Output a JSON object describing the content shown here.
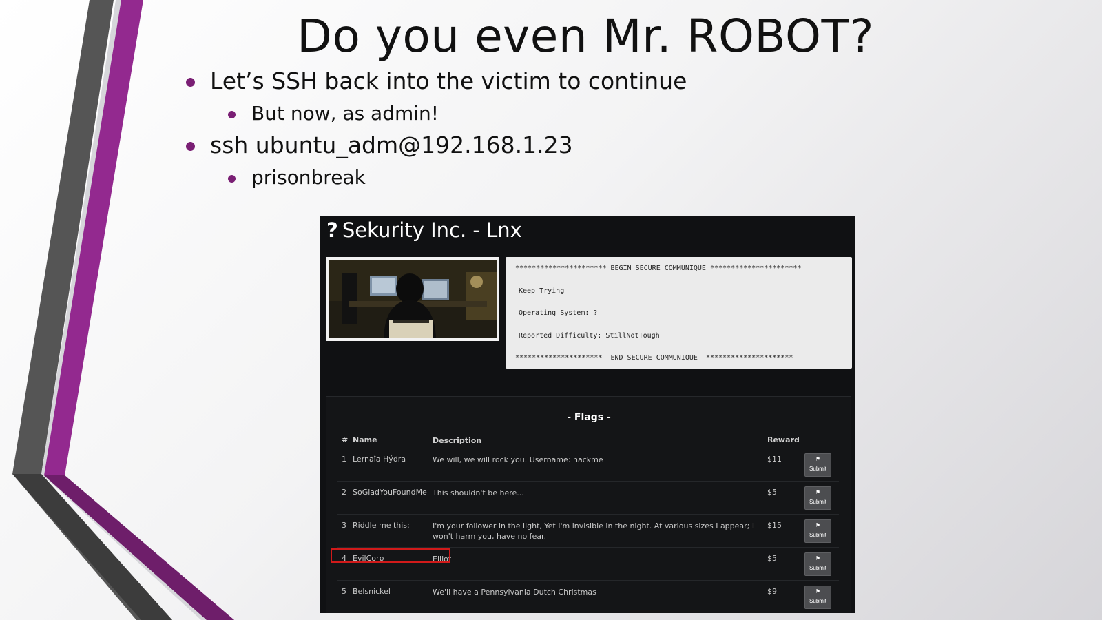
{
  "slide": {
    "title": "Do you even Mr. ROBOT?",
    "bullets": [
      {
        "level": 1,
        "text": "Let’s SSH back into the victim to continue"
      },
      {
        "level": 2,
        "text": "But now, as admin!"
      },
      {
        "level": 1,
        "text": "ssh ubuntu_adm@192.168.1.23"
      },
      {
        "level": 2,
        "text": "prisonbreak"
      }
    ],
    "accent_color": "#7a1f74"
  },
  "app": {
    "header_icon": "question-mark-icon",
    "header_symbol": "?",
    "title": "Sekurity Inc. - Lnx",
    "communique": {
      "begin": "********************** BEGIN SECURE COMMUNIQUE **********************",
      "line1": "Keep Trying",
      "line2": "Operating System: ?",
      "line3": "Reported Difficulty: StillNotTough",
      "end": "*********************  END SECURE COMMUNIQUE  *********************"
    },
    "flags": {
      "title": "- Flags -",
      "columns": {
        "num": "#",
        "name": "Name",
        "description": "Description",
        "reward": "Reward"
      },
      "submit_label": "Submit",
      "rows": [
        {
          "num": "1",
          "name": "Lernaîa Hýdra",
          "description": "We will, we will rock you. Username: hackme",
          "reward": "$11"
        },
        {
          "num": "2",
          "name": "SoGladYouFoundMe",
          "description": "This shouldn't be here...",
          "reward": "$5"
        },
        {
          "num": "3",
          "name": "Riddle me this:",
          "description": "I'm your follower in the light, Yet I'm invisible in the night. At various sizes I appear; I won't harm you, have no fear.",
          "reward": "$15"
        },
        {
          "num": "4",
          "name": "EvilCorp",
          "description": "Elliot",
          "reward": "$5"
        },
        {
          "num": "5",
          "name": "Belsnickel",
          "description": "We'll have a Pennsylvania Dutch Christmas",
          "reward": "$9"
        }
      ]
    },
    "highlight_color": "#d11a1a"
  }
}
